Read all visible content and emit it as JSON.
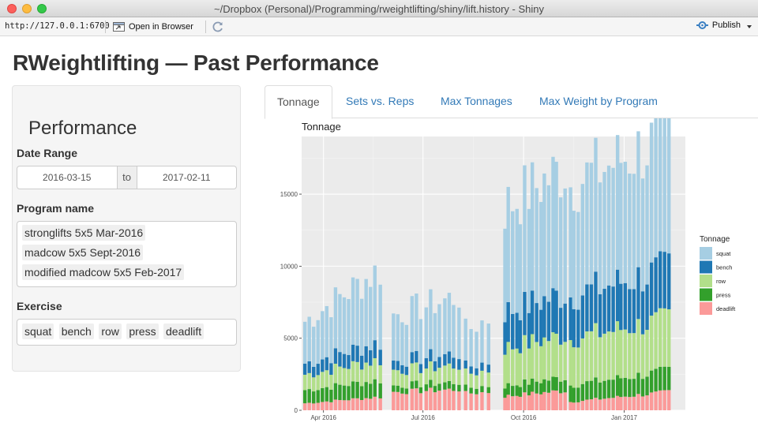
{
  "window": {
    "title": "~/Dropbox (Personal)/Programming/rweightlifting/shiny/lift.history - Shiny"
  },
  "toolbar": {
    "url": "http://127.0.0.1:6700",
    "open_in_browser": "Open in Browser",
    "publish": "Publish"
  },
  "page": {
    "title": "RWeightlifting — Past Performance"
  },
  "sidebar": {
    "heading": "Performance",
    "date_range_label": "Date Range",
    "date_start": "2016-03-15",
    "date_to": "to",
    "date_end": "2017-02-11",
    "program_label": "Program name",
    "programs": [
      "stronglifts 5x5 Mar-2016",
      "madcow 5x5 Sept-2016",
      "modified madcow 5x5 Feb-2017"
    ],
    "exercise_label": "Exercise",
    "exercises": [
      "squat",
      "bench",
      "row",
      "press",
      "deadlift"
    ]
  },
  "tabs": [
    {
      "label": "Tonnage",
      "active": true
    },
    {
      "label": "Sets vs. Reps",
      "active": false
    },
    {
      "label": "Max Tonnages",
      "active": false
    },
    {
      "label": "Max Weight by Program",
      "active": false
    }
  ],
  "colors": {
    "squat": "#a6cee3",
    "bench": "#1f78b4",
    "row": "#b2df8a",
    "press": "#33a02c",
    "deadlift": "#fb9a99",
    "panel": "#ebebeb",
    "link": "#337ab7"
  },
  "chart_data": {
    "type": "bar",
    "stacked": true,
    "title": "Tonnage",
    "xlabel": "",
    "ylabel": "",
    "ylim": [
      0,
      19000
    ],
    "yticks": [
      0,
      5000,
      10000,
      15000
    ],
    "xlim": [
      "2016-03-12",
      "2017-02-26"
    ],
    "xticks": [
      {
        "date": "2016-04-01",
        "label": "Apr 2016"
      },
      {
        "date": "2016-07-01",
        "label": "Jul 2016"
      },
      {
        "date": "2016-10-01",
        "label": "Oct 2016"
      },
      {
        "date": "2017-01-01",
        "label": "Jan 2017"
      }
    ],
    "legend": {
      "title": "Tonnage",
      "position": "right",
      "entries": [
        "squat",
        "bench",
        "row",
        "press",
        "deadlift"
      ]
    },
    "grid": true,
    "segments": [
      {
        "start": "2016-03-15",
        "end": "2016-05-23",
        "sessions": 18,
        "base": [
          3000,
          800,
          1100,
          950,
          500
        ],
        "growth": [
          2200,
          450,
          350,
          250,
          450
        ]
      },
      {
        "start": "2016-06-04",
        "end": "2016-08-03",
        "sessions": 15,
        "base": [
          3300,
          650,
          1100,
          450,
          1300
        ],
        "growth": [
          800,
          200,
          100,
          80,
          200
        ]
      },
      {
        "start": "2016-08-09",
        "end": "2016-08-30",
        "sessions": 5,
        "base": [
          2600,
          500,
          1000,
          400,
          1200
        ],
        "growth": [
          500,
          100,
          100,
          50,
          100
        ]
      },
      {
        "start": "2016-09-14",
        "end": "2016-11-08",
        "sessions": 16,
        "base": [
          7500,
          2600,
          2700,
          750,
          1000
        ],
        "growth": [
          1500,
          400,
          300,
          200,
          400
        ]
      },
      {
        "start": "2016-11-13",
        "end": "2017-02-11",
        "sessions": 24,
        "base": [
          8000,
          3100,
          3300,
          1200,
          600
        ],
        "growth": [
          1500,
          500,
          400,
          300,
          700
        ]
      }
    ]
  }
}
